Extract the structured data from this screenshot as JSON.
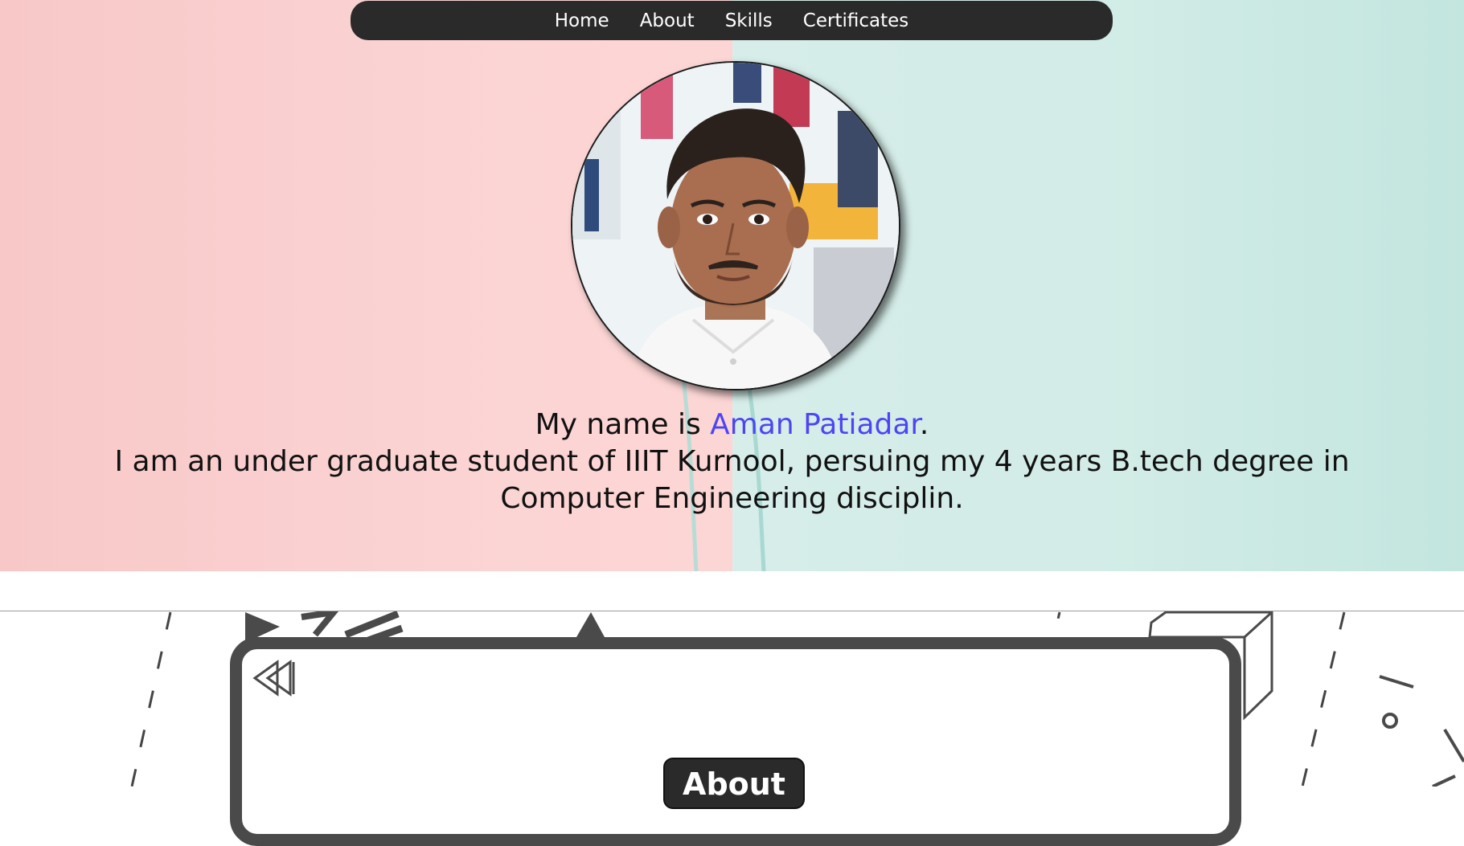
{
  "nav": {
    "items": [
      {
        "label": "Home"
      },
      {
        "label": "About"
      },
      {
        "label": "Skills"
      },
      {
        "label": "Certificates"
      }
    ]
  },
  "hero": {
    "intro_prefix": "My name is ",
    "name": "Aman Patiadar",
    "intro_suffix": ".",
    "description": "I am an under graduate student of IIIT Kurnool, persuing my 4 years B.tech degree in Computer Engineering disciplin."
  },
  "about": {
    "title": "About"
  },
  "colors": {
    "nav_bg": "#2b2a2a",
    "name_accent": "#4d45f5",
    "hero_left": "#fbd3d3",
    "hero_right": "#d3ece7",
    "frame": "#4a4a4a"
  }
}
